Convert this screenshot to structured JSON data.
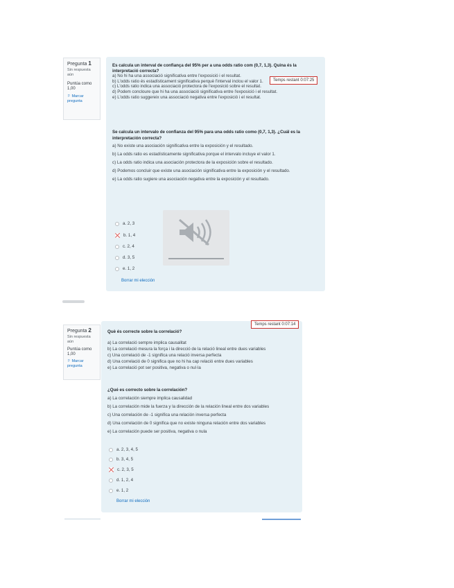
{
  "q1": {
    "info": {
      "title_prefix": "Pregunta",
      "number": "1",
      "status": "Sin respuesta aún",
      "points": "Puntúa como 1,00",
      "flag": "Marcar pregunta"
    },
    "timer": "Temps restant 0:07:25",
    "question_ca": "Es calcula un interval de confiança del 95% per a una odds ratio com (0,7, 1,3). Quina és la interpretació correcta?",
    "options_ca": [
      "a) No hi ha una associació significativa entre l'exposició i el resultat.",
      "b) L'odds ratio és estadísticament significativa perquè l'interval inclou el valor 1.",
      "c) L'odds ratio indica una associació protectora de l'exposició sobre el resultat.",
      "d) Podem concloure que hi ha una associació significativa entre l'exposició i el resultat.",
      "e) L'odds ratio suggereix una associació negativa entre l'exposició i el resultat."
    ],
    "question_es": "Se calcula un intervalo de confianza del 95% para una odds ratio como (0,7, 1,3). ¿Cuál es la interpretación correcta?",
    "options_es": [
      "a) No existe una asociación significativa entre la exposición y el resultado.",
      "b) La odds ratio es estadísticamente significativa porque el intervalo incluye el valor 1.",
      "c) La odds ratio indica una asociación protectora de la exposición sobre el resultado.",
      "d) Podemos concluir que existe una asociación significativa entre la exposición y el resultado.",
      "e) La odds ratio sugiere una asociación negativa entre la exposición y el resultado."
    ],
    "choices": [
      {
        "label": "a. 2, 3",
        "selected": false
      },
      {
        "label": "b. 1, 4",
        "selected": true
      },
      {
        "label": "c. 2, 4",
        "selected": false
      },
      {
        "label": "d. 3, 5",
        "selected": false
      },
      {
        "label": "e. 1, 2",
        "selected": false
      }
    ],
    "clear_link": "Borrar mi elección",
    "media_icon": "muted-speaker-icon"
  },
  "q2": {
    "info": {
      "title_prefix": "Pregunta",
      "number": "2",
      "status": "Sin respuesta aún",
      "points": "Puntúa como 1,00",
      "flag": "Marcar pregunta"
    },
    "timer": "Temps restant 0:07:14",
    "question_ca": "Què és correcte sobre la correlació?",
    "options_ca": [
      "a) La correlació sempre implica causalitat",
      "b) La correlació mesura la força i la direcció de la relació lineal entre dues variables",
      "c) Una correlació de -1 significa una relació inversa perfecta",
      "d) Una correlació de 0 significa que no hi ha cap relació entre dues variables",
      "e) La correlació pot ser positiva, negativa o nul·la"
    ],
    "question_es": "¿Qué es correcto sobre la correlación?",
    "options_es": [
      "a) La correlación siempre implica causalidad",
      "b) La correlación mide la fuerza y la dirección de la relación lineal entre dos variables",
      "c) Una correlación de -1 significa una relación inversa perfecta",
      "d) Una correlación de 0 significa que no existe ninguna relación entre dos variables",
      "e) La correlación puede ser positiva, negativa o nula"
    ],
    "choices": [
      {
        "label": "a. 2, 3, 4, 5",
        "selected": false
      },
      {
        "label": "b. 3, 4, 5",
        "selected": false
      },
      {
        "label": "c. 2, 3, 5",
        "selected": true
      },
      {
        "label": "d. 1, 2, 4",
        "selected": false
      },
      {
        "label": "e. 1, 2",
        "selected": false
      }
    ],
    "clear_link": "Borrar mi elección"
  },
  "colors": {
    "card_bg": "#e7f1f6",
    "link": "#0f6cbf",
    "selected_mark": "#d9534f",
    "timer_border": "#c9302c"
  }
}
